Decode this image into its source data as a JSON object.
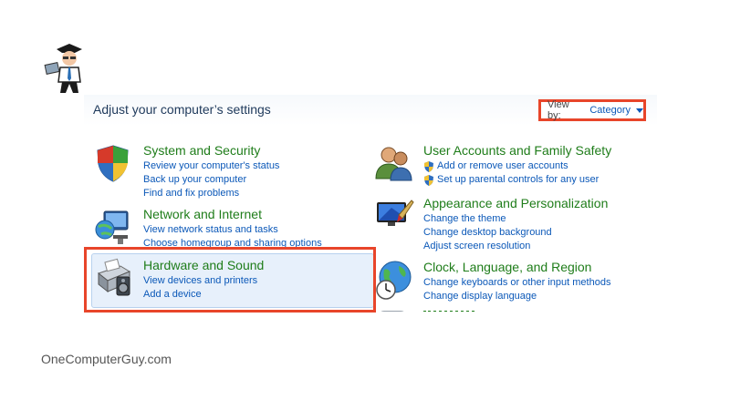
{
  "panel": {
    "title": "Adjust your computer’s settings",
    "view_by": {
      "label": "View by:",
      "value": "Category"
    }
  },
  "categories": [
    {
      "title": "System and Security",
      "icon": "shield-security-icon",
      "links": [
        "Review your computer's status",
        "Back up your computer",
        "Find and fix problems"
      ]
    },
    {
      "title": "Network and Internet",
      "icon": "network-globe-icon",
      "links": [
        "View network status and tasks",
        "Choose homegroup and sharing options"
      ]
    },
    {
      "title": "Hardware and Sound",
      "icon": "printer-speaker-icon",
      "links": [
        "View devices and printers",
        "Add a device"
      ]
    },
    {
      "title": "User Accounts and Family Safety",
      "icon": "users-icon",
      "links": [
        "Add or remove user accounts",
        "Set up parental controls for any user"
      ]
    },
    {
      "title": "Appearance and Personalization",
      "icon": "monitor-paint-icon",
      "links": [
        "Change the theme",
        "Change desktop background",
        "Adjust screen resolution"
      ]
    },
    {
      "title": "Clock, Language, and Region",
      "icon": "globe-clock-icon",
      "links": [
        "Change keyboards or other input methods",
        "Change display language"
      ]
    }
  ],
  "watermark": "OneComputerGuy.com",
  "colors": {
    "highlight_border": "#e8452a",
    "link": "#0b58b8",
    "category_title": "#1f7d1a"
  }
}
